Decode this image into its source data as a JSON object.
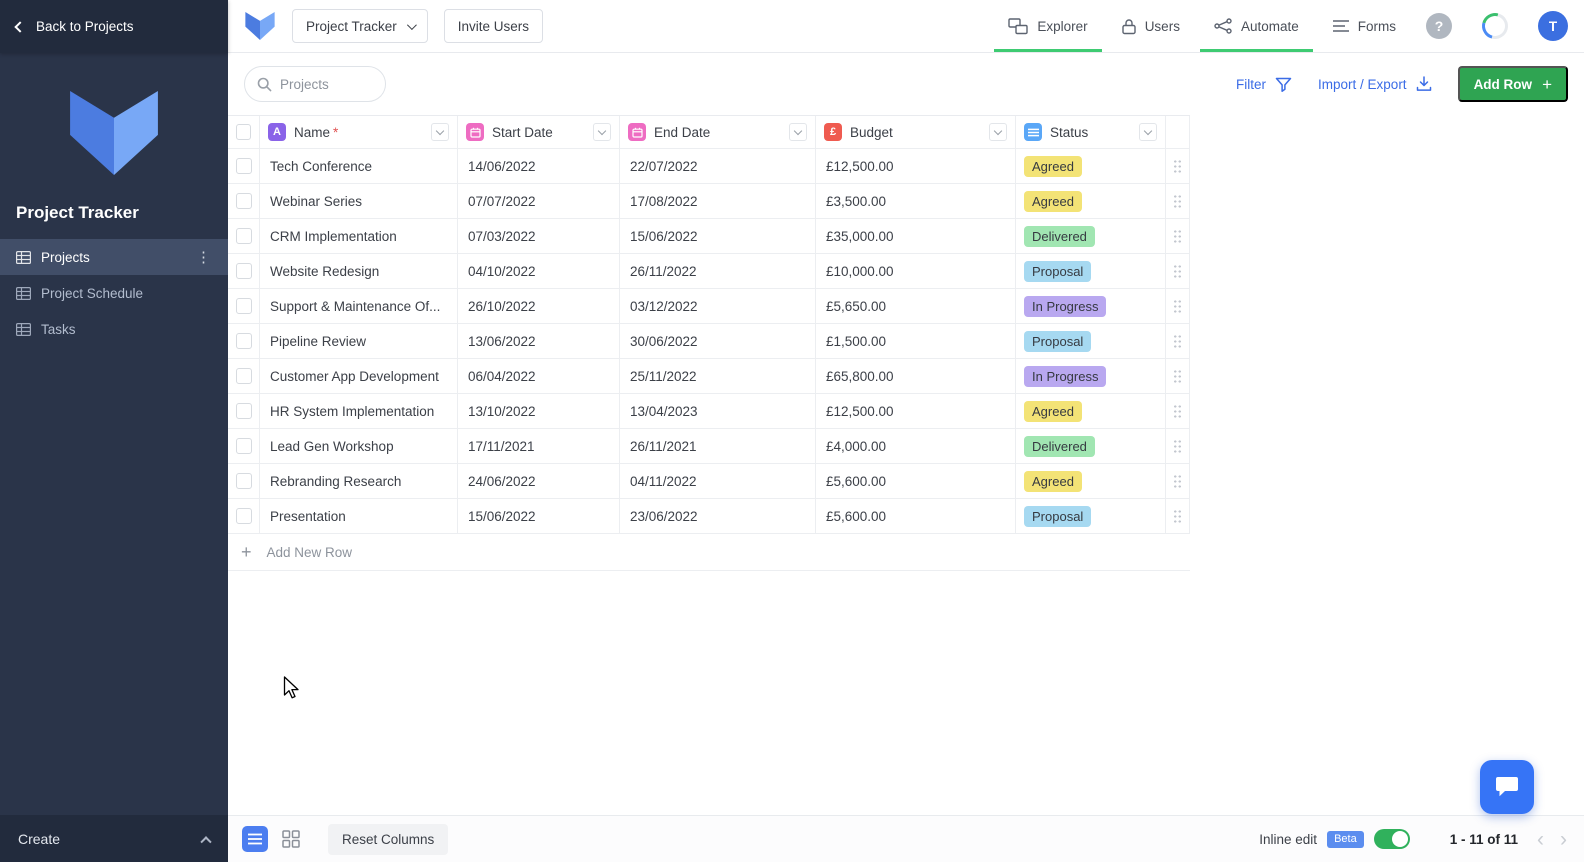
{
  "sidebar": {
    "back_label": "Back to Projects",
    "workspace_title": "Project Tracker",
    "items": [
      {
        "label": "Projects",
        "active": true
      },
      {
        "label": "Project Schedule",
        "active": false
      },
      {
        "label": "Tasks",
        "active": false
      }
    ],
    "create_label": "Create"
  },
  "header": {
    "project_selector": "Project Tracker",
    "invite_users_label": "Invite Users",
    "nav": [
      {
        "label": "Explorer",
        "icon": "explorer-icon",
        "underline": true
      },
      {
        "label": "Users",
        "icon": "users-lock-icon",
        "underline": false
      },
      {
        "label": "Automate",
        "icon": "automate-icon",
        "underline": true
      },
      {
        "label": "Forms",
        "icon": "forms-icon",
        "underline": false
      }
    ],
    "avatar_initial": "T"
  },
  "toolbar": {
    "search_placeholder": "Projects",
    "filter_label": "Filter",
    "import_export_label": "Import / Export",
    "add_row_label": "Add Row"
  },
  "table": {
    "columns": [
      {
        "key": "name",
        "label": "Name",
        "required": true,
        "type": "text",
        "icon": "text-field-icon",
        "color": "#8a63e8"
      },
      {
        "key": "start",
        "label": "Start Date",
        "required": false,
        "type": "calendar",
        "icon": "calendar-icon",
        "color": "#ee6cc2"
      },
      {
        "key": "end",
        "label": "End Date",
        "required": false,
        "type": "calendar",
        "icon": "calendar-icon",
        "color": "#ee6cc2"
      },
      {
        "key": "budget",
        "label": "Budget",
        "required": false,
        "type": "currency",
        "icon": "currency-pound-icon",
        "color": "#ef5b50"
      },
      {
        "key": "status",
        "label": "Status",
        "required": false,
        "type": "select",
        "icon": "single-select-icon",
        "color": "#5aa7f7"
      }
    ],
    "rows": [
      {
        "name": "Tech Conference",
        "start": "14/06/2022",
        "end": "22/07/2022",
        "budget": "£12,500.00",
        "status": "Agreed"
      },
      {
        "name": "Webinar Series",
        "start": "07/07/2022",
        "end": "17/08/2022",
        "budget": "£3,500.00",
        "status": "Agreed"
      },
      {
        "name": "CRM Implementation",
        "start": "07/03/2022",
        "end": "15/06/2022",
        "budget": "£35,000.00",
        "status": "Delivered"
      },
      {
        "name": "Website Redesign",
        "start": "04/10/2022",
        "end": "26/11/2022",
        "budget": "£10,000.00",
        "status": "Proposal"
      },
      {
        "name": "Support & Maintenance Of...",
        "start": "26/10/2022",
        "end": "03/12/2022",
        "budget": "£5,650.00",
        "status": "In Progress"
      },
      {
        "name": "Pipeline Review",
        "start": "13/06/2022",
        "end": "30/06/2022",
        "budget": "£1,500.00",
        "status": "Proposal"
      },
      {
        "name": "Customer App Development",
        "start": "06/04/2022",
        "end": "25/11/2022",
        "budget": "£65,800.00",
        "status": "In Progress"
      },
      {
        "name": "HR System Implementation",
        "start": "13/10/2022",
        "end": "13/04/2023",
        "budget": "£12,500.00",
        "status": "Agreed"
      },
      {
        "name": "Lead Gen Workshop",
        "start": "17/11/2021",
        "end": "26/11/2021",
        "budget": "£4,000.00",
        "status": "Delivered"
      },
      {
        "name": "Rebranding Research",
        "start": "24/06/2022",
        "end": "04/11/2022",
        "budget": "£5,600.00",
        "status": "Agreed"
      },
      {
        "name": "Presentation",
        "start": "15/06/2022",
        "end": "23/06/2022",
        "budget": "£5,600.00",
        "status": "Proposal"
      }
    ],
    "status_colors": {
      "Agreed": "#f3e376",
      "Delivered": "#a1e6b2",
      "Proposal": "#a6d9f1",
      "In Progress": "#b9a8f0"
    },
    "add_new_row_label": "Add New Row"
  },
  "footer": {
    "reset_columns_label": "Reset Columns",
    "inline_edit_label": "Inline edit",
    "beta_label": "Beta",
    "pagination": "1 - 11 of 11"
  },
  "colors": {
    "primary_blue": "#3b6ce6",
    "add_row_green": "#2fa452",
    "sidebar_bg": "#2a3449",
    "nav_underline_green": "#3ecb72"
  }
}
